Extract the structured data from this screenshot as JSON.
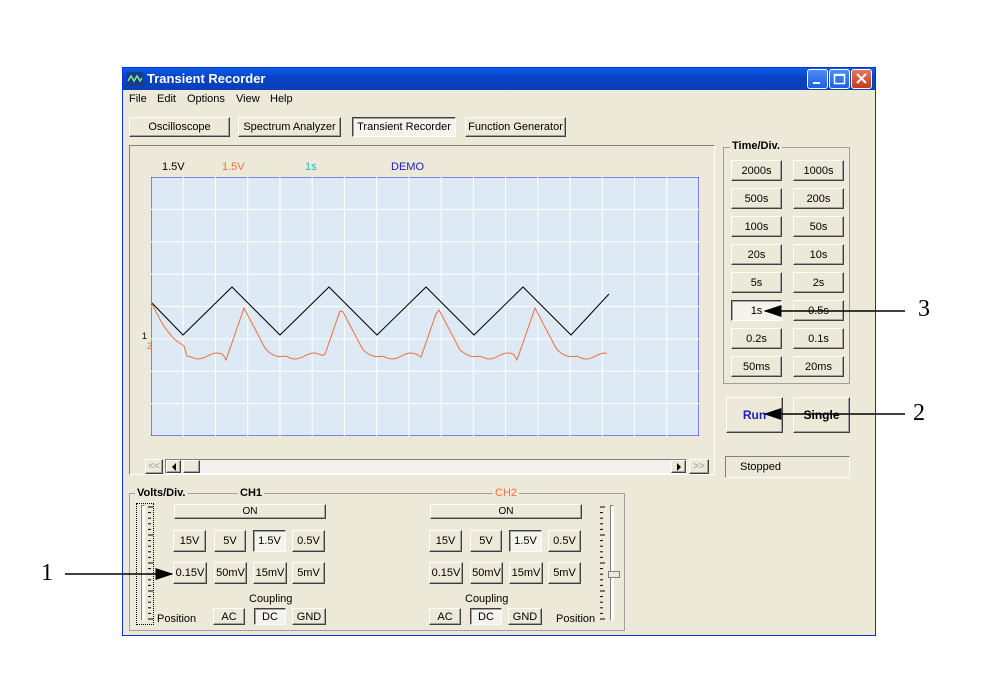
{
  "window": {
    "title": "Transient Recorder"
  },
  "menu": [
    "File",
    "Edit",
    "Options",
    "View",
    "Help"
  ],
  "modes": [
    {
      "label": "Oscilloscope",
      "active": false
    },
    {
      "label": "Spectrum Analyzer",
      "active": false
    },
    {
      "label": "Transient Recorder",
      "active": true
    },
    {
      "label": "Function Generator",
      "active": false
    }
  ],
  "scope": {
    "ch1_volts": "1.5V",
    "ch2_volts": "1.5V",
    "time_div": "1s",
    "mode": "DEMO",
    "marker1": "1",
    "marker2": "2",
    "colors": {
      "ch1": "#000000",
      "ch2": "#f07040",
      "time": "#20b8c8",
      "demo": "#1c1cc8",
      "grid_bg": "#dde9f4"
    }
  },
  "time_div": {
    "title": "Time/Div.",
    "buttons": [
      "2000s",
      "1000s",
      "500s",
      "200s",
      "100s",
      "50s",
      "20s",
      "10s",
      "5s",
      "2s",
      "1s",
      "0.5s",
      "0.2s",
      "0.1s",
      "50ms",
      "20ms"
    ],
    "selected": "1s"
  },
  "controls": {
    "run": "Run",
    "single": "Single",
    "status": "Stopped"
  },
  "volts": {
    "title": "Volts/Div.",
    "ch1_title": "CH1",
    "ch2_title": "CH2",
    "ch1_state": "ON",
    "ch2_state": "ON",
    "ranges_row1": [
      "15V",
      "5V",
      "1.5V",
      "0.5V"
    ],
    "ranges_row2": [
      "0.15V",
      "50mV",
      "15mV",
      "5mV"
    ],
    "selected": "1.5V",
    "coupling_label": "Coupling",
    "coupling": [
      "AC",
      "DC",
      "GND"
    ],
    "coupling_selected": "DC",
    "position_label": "Position"
  },
  "callouts": [
    "1",
    "2",
    "3"
  ]
}
